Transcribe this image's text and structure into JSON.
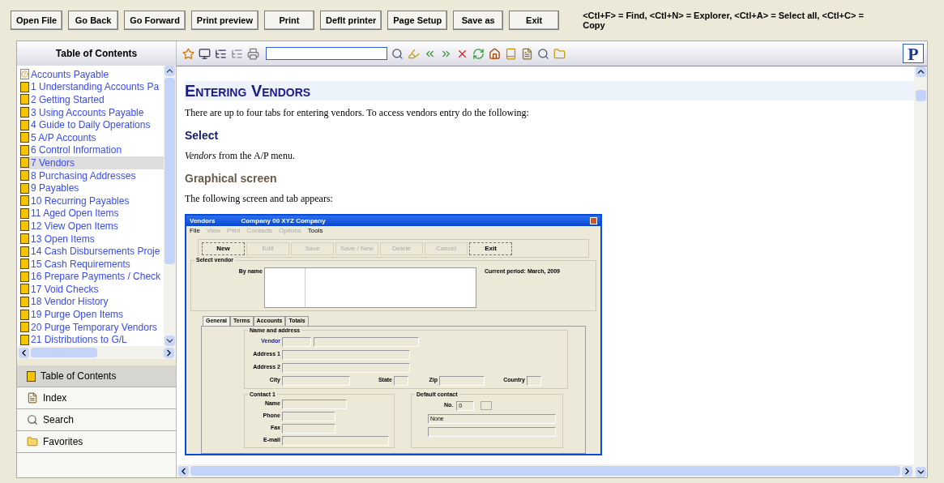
{
  "toolbar": {
    "buttons": [
      {
        "label": "Open File"
      },
      {
        "label": "Go Back"
      },
      {
        "label": "Go Forward"
      },
      {
        "label": "Print preview"
      },
      {
        "label": "Print"
      },
      {
        "label": "Deflt printer"
      },
      {
        "label": "Page Setup"
      },
      {
        "label": "Save as"
      },
      {
        "label": "Exit"
      }
    ],
    "shortcuts": "<Ctl+F> = Find, <Ctl+N> = Explorer, <Ctl+A> = Select all, <Ctl+C> = Copy"
  },
  "sidebar": {
    "title": "Table of Contents",
    "items": [
      {
        "label": "Accounts Payable",
        "kind": "page",
        "selected": false
      },
      {
        "label": "1 Understanding Accounts Pa",
        "kind": "book",
        "selected": false
      },
      {
        "label": "2 Getting Started",
        "kind": "book",
        "selected": false
      },
      {
        "label": "3 Using Accounts Payable",
        "kind": "book",
        "selected": false
      },
      {
        "label": "4 Guide to Daily Operations",
        "kind": "book",
        "selected": false
      },
      {
        "label": "5 A/P Accounts",
        "kind": "book",
        "selected": false
      },
      {
        "label": "6 Control Information",
        "kind": "book",
        "selected": false
      },
      {
        "label": "7 Vendors",
        "kind": "book",
        "selected": true
      },
      {
        "label": "8 Purchasing Addresses",
        "kind": "book",
        "selected": false
      },
      {
        "label": "9 Payables",
        "kind": "book",
        "selected": false
      },
      {
        "label": "10 Recurring Payables",
        "kind": "book",
        "selected": false
      },
      {
        "label": "11 Aged Open Items",
        "kind": "book",
        "selected": false
      },
      {
        "label": "12 View Open Items",
        "kind": "book",
        "selected": false
      },
      {
        "label": "13 Open Items",
        "kind": "book",
        "selected": false
      },
      {
        "label": "14 Cash Disbursements Proje",
        "kind": "book",
        "selected": false
      },
      {
        "label": "15 Cash Requirements",
        "kind": "book",
        "selected": false
      },
      {
        "label": "16 Prepare Payments / Check",
        "kind": "book",
        "selected": false
      },
      {
        "label": "17 Void Checks",
        "kind": "book",
        "selected": false
      },
      {
        "label": "18 Vendor History",
        "kind": "book",
        "selected": false
      },
      {
        "label": "19 Purge Open Items",
        "kind": "book",
        "selected": false
      },
      {
        "label": "20 Purge Temporary Vendors",
        "kind": "book",
        "selected": false
      },
      {
        "label": "21 Distributions to G/L",
        "kind": "book",
        "selected": false
      }
    ],
    "nav_tabs": [
      {
        "label": "Table of Contents",
        "kind": "contents",
        "selected": true
      },
      {
        "label": "Index",
        "kind": "index",
        "selected": false
      },
      {
        "label": "Search",
        "kind": "search",
        "selected": false
      },
      {
        "label": "Favorites",
        "kind": "favorites",
        "selected": false
      }
    ]
  },
  "viewer_toolbar": {
    "logo": "P"
  },
  "content": {
    "heading": "Entering Vendors",
    "intro": "There are up to four tabs for entering vendors. To access vendors entry do the following:",
    "select_heading": "Select",
    "select_text": "*Vendors* from the A/P menu.",
    "graphical_heading": "Graphical screen",
    "graphical_text": "The following screen and tab appears:",
    "screenshot": {
      "title": "Vendors",
      "company": "Company 00  XYZ Company",
      "menu": [
        {
          "label": "File",
          "disabled": false
        },
        {
          "label": "View",
          "disabled": true
        },
        {
          "label": "Print",
          "disabled": true
        },
        {
          "label": "Contacts",
          "disabled": true
        },
        {
          "label": "Options",
          "disabled": true
        },
        {
          "label": "Tools",
          "disabled": false
        }
      ],
      "buttons": [
        {
          "label": "New",
          "disabled": false
        },
        {
          "label": "Edit",
          "disabled": true
        },
        {
          "label": "Save",
          "disabled": true
        },
        {
          "label": "Save / New",
          "disabled": true
        },
        {
          "label": "Delete",
          "disabled": true
        },
        {
          "label": "Cancel",
          "disabled": true
        },
        {
          "label": "Exit",
          "disabled": false
        }
      ],
      "select_group": "Select vendor",
      "by_name": "By name",
      "period": "Current period: March, 2009",
      "tabs": [
        {
          "label": "General",
          "selected": true
        },
        {
          "label": "Terms",
          "selected": false
        },
        {
          "label": "Accounts",
          "selected": false
        },
        {
          "label": "Totals",
          "selected": false
        }
      ],
      "name_group": "Name and address",
      "vendor": "Vendor",
      "address1": "Address 1",
      "address2": "Address 2",
      "city": "City",
      "state": "State",
      "zip": "Zip",
      "country": "Country",
      "contact_group": "Contact 1",
      "name": "Name",
      "phone": "Phone",
      "fax": "Fax",
      "email": "E-mail",
      "default_group": "Default contact",
      "no_label": "No.",
      "no_value": "0",
      "default_value": "None"
    }
  }
}
